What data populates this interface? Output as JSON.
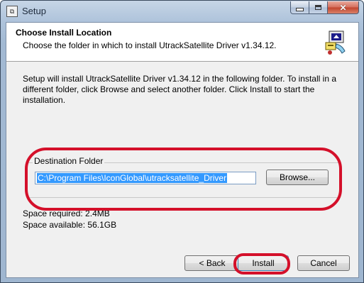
{
  "window": {
    "title": "Setup",
    "app_icon_glyph": "⧉"
  },
  "header": {
    "title": "Choose Install Location",
    "subtitle": "Choose the folder in which to install UtrackSatellite Driver v1.34.12."
  },
  "intro": "Setup will install UtrackSatellite Driver v1.34.12 in the following folder. To install in a different folder, click Browse and select another folder. Click Install to start the installation.",
  "destination": {
    "legend": "Destination Folder",
    "path": "C:\\Program Files\\IconGlobal\\utracksatellite_Driver",
    "browse_label": "Browse..."
  },
  "space": {
    "required": "Space required: 2.4MB",
    "available": "Space available: 56.1GB"
  },
  "buttons": {
    "back": "< Back",
    "install": "Install",
    "cancel": "Cancel"
  },
  "colors": {
    "highlight": "#d4102a",
    "selection": "#3399ff"
  }
}
